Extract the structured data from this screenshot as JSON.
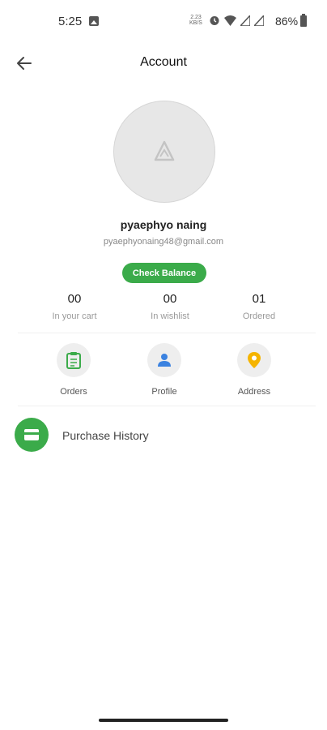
{
  "status_bar": {
    "time": "5:25",
    "speed_value": "2.23",
    "speed_unit": "KB/S",
    "battery": "86%",
    "icons": [
      "gallery-icon",
      "alarm-icon",
      "wifi-icon",
      "signal-icon",
      "signal-icon",
      "battery-icon"
    ]
  },
  "app_bar": {
    "title": "Account",
    "back_icon": "arrow-left-icon"
  },
  "profile": {
    "avatar_icon": "logo-placeholder-icon",
    "name": "pyaephyo naing",
    "email": "pyaephyonaing48@gmail.com",
    "check_balance_label": "Check Balance"
  },
  "stats": [
    {
      "value": "00",
      "label": "In your cart"
    },
    {
      "value": "00",
      "label": "In wishlist"
    },
    {
      "value": "01",
      "label": "Ordered"
    }
  ],
  "actions": [
    {
      "label": "Orders",
      "icon": "clipboard-icon",
      "color": "#3bab4a"
    },
    {
      "label": "Profile",
      "icon": "person-icon",
      "color": "#3b82e0"
    },
    {
      "label": "Address",
      "icon": "location-pin-icon",
      "color": "#f5b400"
    }
  ],
  "menu": [
    {
      "label": "Purchase History",
      "icon": "card-icon",
      "color": "#3bab4a"
    }
  ],
  "colors": {
    "accent": "#3bab4a",
    "muted_text": "#999999"
  }
}
